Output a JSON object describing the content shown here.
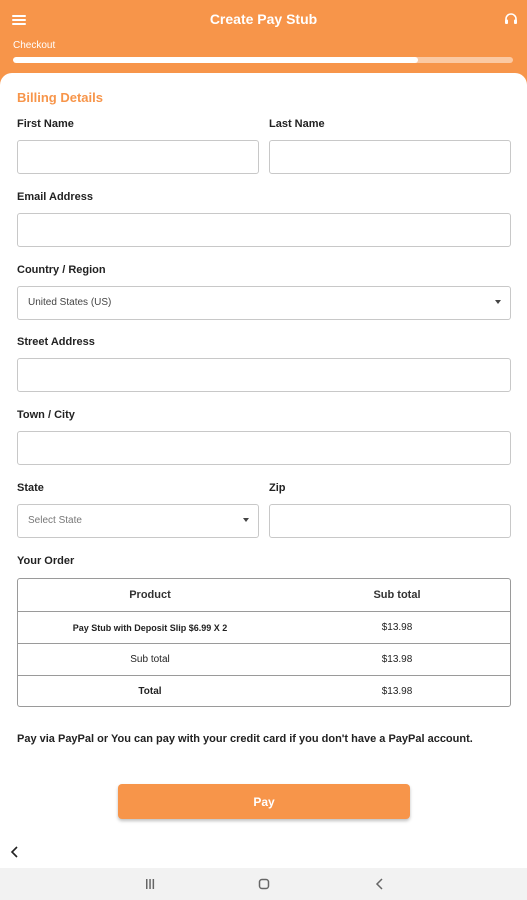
{
  "header": {
    "title": "Create Pay Stub",
    "step_label": "Checkout",
    "progress": 0.81,
    "menu_icon": "hamburger-menu-icon",
    "support_icon": "headset-icon"
  },
  "billing": {
    "title": "Billing Details",
    "first_name": {
      "label": "First Name",
      "value": ""
    },
    "last_name": {
      "label": "Last Name",
      "value": ""
    },
    "email": {
      "label": "Email Address",
      "value": ""
    },
    "country": {
      "label": "Country / Region",
      "value": "United States (US)"
    },
    "street": {
      "label": "Street Address",
      "value": ""
    },
    "city": {
      "label": "Town / City",
      "value": ""
    },
    "state": {
      "label": "State",
      "placeholder": "Select State"
    },
    "zip": {
      "label": "Zip",
      "value": ""
    }
  },
  "order": {
    "title": "Your Order",
    "columns": [
      "Product",
      "Sub total"
    ],
    "item": {
      "name": "Pay Stub with Deposit Slip $6.99 X 2",
      "amount": "$13.98"
    },
    "subtotal": {
      "label": "Sub total",
      "amount": "$13.98"
    },
    "total": {
      "label": "Total",
      "amount": "$13.98"
    }
  },
  "payment": {
    "note": "Pay via PayPal or You can pay with your credit card if you don't have a PayPal account.",
    "button_label": "Pay"
  },
  "colors": {
    "accent": "#f7954a",
    "accent_light": "#fbc9a3",
    "border": "#c8c8c8",
    "navbar": "#f2f2f2"
  },
  "system_nav": {
    "icons": [
      "back-arrow-icon",
      "recent-apps-icon",
      "home-icon",
      "system-back-icon"
    ]
  }
}
